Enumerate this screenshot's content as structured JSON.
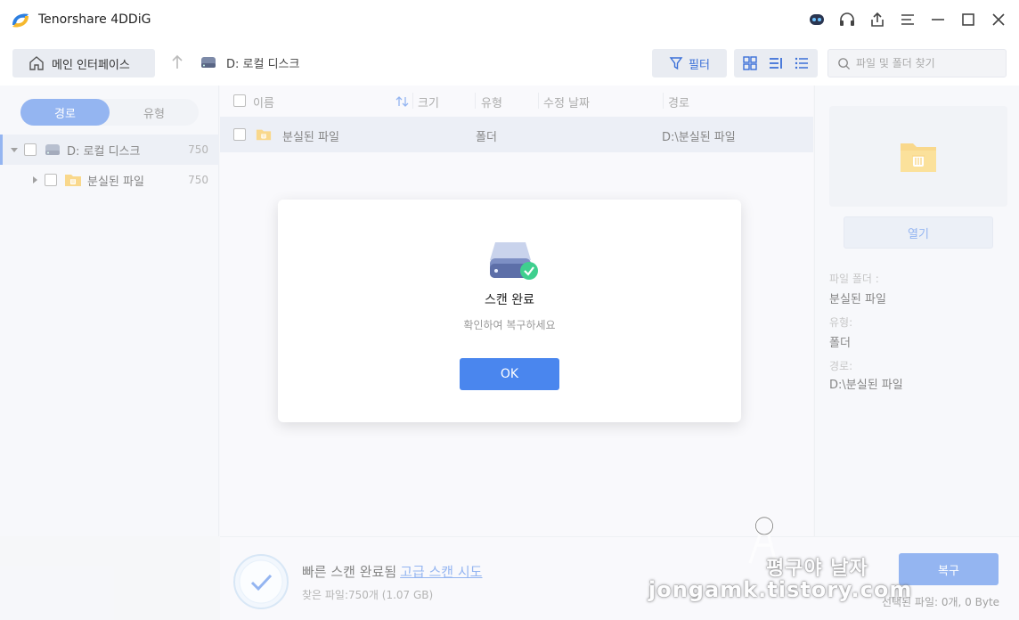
{
  "window": {
    "title": "Tenorshare 4DDiG"
  },
  "toolbar": {
    "home_label": "메인 인터페이스",
    "breadcrumb": "D: 로컬 디스크",
    "filter_label": "필터",
    "search_placeholder": "파일 및 폴더 찾기"
  },
  "sidebar": {
    "tabs": [
      {
        "label": "경로",
        "active": true
      },
      {
        "label": "유형",
        "active": false
      }
    ],
    "tree": [
      {
        "label": "D: 로컬 디스크",
        "count": "750",
        "expanded": true,
        "selected": true
      },
      {
        "label": "분실된 파일",
        "count": "750",
        "expanded": false,
        "selected": false
      }
    ]
  },
  "list": {
    "columns": [
      "이름",
      "크기",
      "유형",
      "수정 날짜",
      "경로"
    ],
    "rows": [
      {
        "name": "분실된 파일",
        "size": "",
        "type": "폴더",
        "modified": "",
        "path": "D:\\분실된 파일"
      }
    ]
  },
  "details": {
    "open_label": "열기",
    "folder_label": "파일 폴더 :",
    "folder_value": "분실된 파일",
    "type_label": "유형:",
    "type_value": "폴더",
    "path_label": "경로:",
    "path_value": "D:\\분실된 파일"
  },
  "status": {
    "scan_done": "빠른 스캔 완료됨",
    "deep_scan_link": "고급 스캔 시도",
    "found_files": "찾은 파일:750개 (1.07 GB)",
    "recover_label": "복구",
    "selected_info": "선택된 파일: 0개, 0 Byte"
  },
  "dialog": {
    "title": "스캔 완료",
    "message": "확인하여 복구하세요",
    "ok_label": "OK"
  },
  "watermark": {
    "line1": "평구야 날자",
    "line2": "jongamk.tistory.com"
  },
  "colors": {
    "accent": "#3d78e6",
    "folder": "#f5b82e",
    "success": "#3fcf8e"
  }
}
